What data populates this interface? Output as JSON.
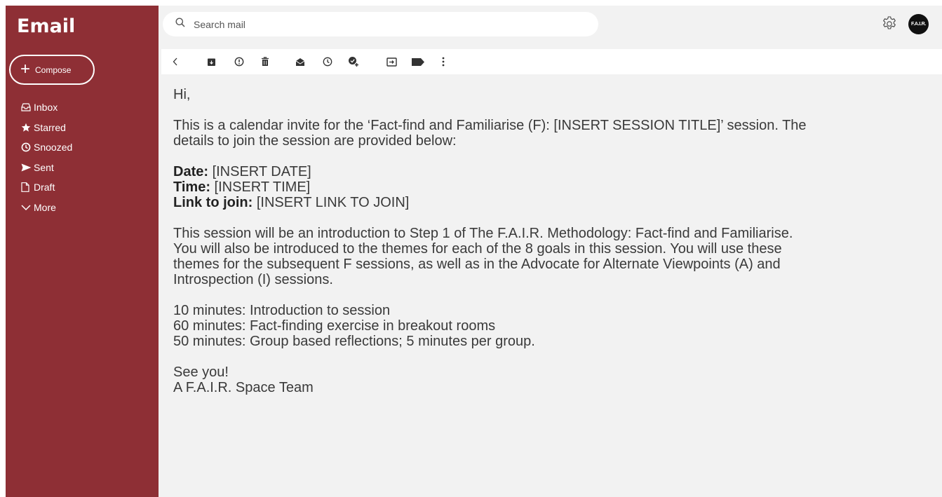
{
  "app": {
    "title": "Email"
  },
  "compose": {
    "label": "Compose"
  },
  "sidebar": {
    "items": [
      {
        "label": "Inbox",
        "icon": "inbox-icon"
      },
      {
        "label": "Starred",
        "icon": "star-icon"
      },
      {
        "label": "Snoozed",
        "icon": "clock-icon"
      },
      {
        "label": "Sent",
        "icon": "send-icon"
      },
      {
        "label": "Draft",
        "icon": "draft-icon"
      },
      {
        "label": "More",
        "icon": "chevron-down-icon"
      }
    ]
  },
  "search": {
    "placeholder": "Search mail",
    "value": ""
  },
  "header": {
    "avatar_text": "F.A.I.R."
  },
  "toolbar": {
    "icons": [
      "back-icon",
      "archive-icon",
      "report-spam-icon",
      "delete-icon",
      "mark-unread-icon",
      "snooze-icon",
      "add-task-icon",
      "move-to-icon",
      "label-icon",
      "more-options-icon"
    ]
  },
  "message": {
    "greeting": "Hi,",
    "intro_line1": "This is a calendar invite for the ‘Fact-find and Familiarise (F): [INSERT SESSION TITLE]’ session. The",
    "intro_line2": "details to join the session are provided below:",
    "date_label": "Date:",
    "date_value": " [INSERT DATE]",
    "time_label": "Time:",
    "time_value": " [INSERT TIME]",
    "link_label": "Link to join:",
    "link_value": " [INSERT LINK TO JOIN]",
    "para_line1": "This session will be an introduction to Step 1 of The F.A.I.R. Methodology: Fact-find and Familiarise.",
    "para_line2": "You will also be introduced to the themes for each of the 8 goals in this session. You will use these",
    "para_line3": "themes for the subsequent F sessions, as well as in the Advocate for Alternate Viewpoints (A) and",
    "para_line4": "Introspection (I) sessions.",
    "agenda": [
      "10 minutes: Introduction to session",
      "60 minutes: Fact-finding exercise in breakout rooms",
      "50 minutes: Group based reflections; 5 minutes per group."
    ],
    "signoff": "See you!",
    "signature": "A F.A.I.R. Space Team"
  },
  "colors": {
    "sidebar_bg": "#8e2f35",
    "page_bg": "#f2f2f2"
  }
}
